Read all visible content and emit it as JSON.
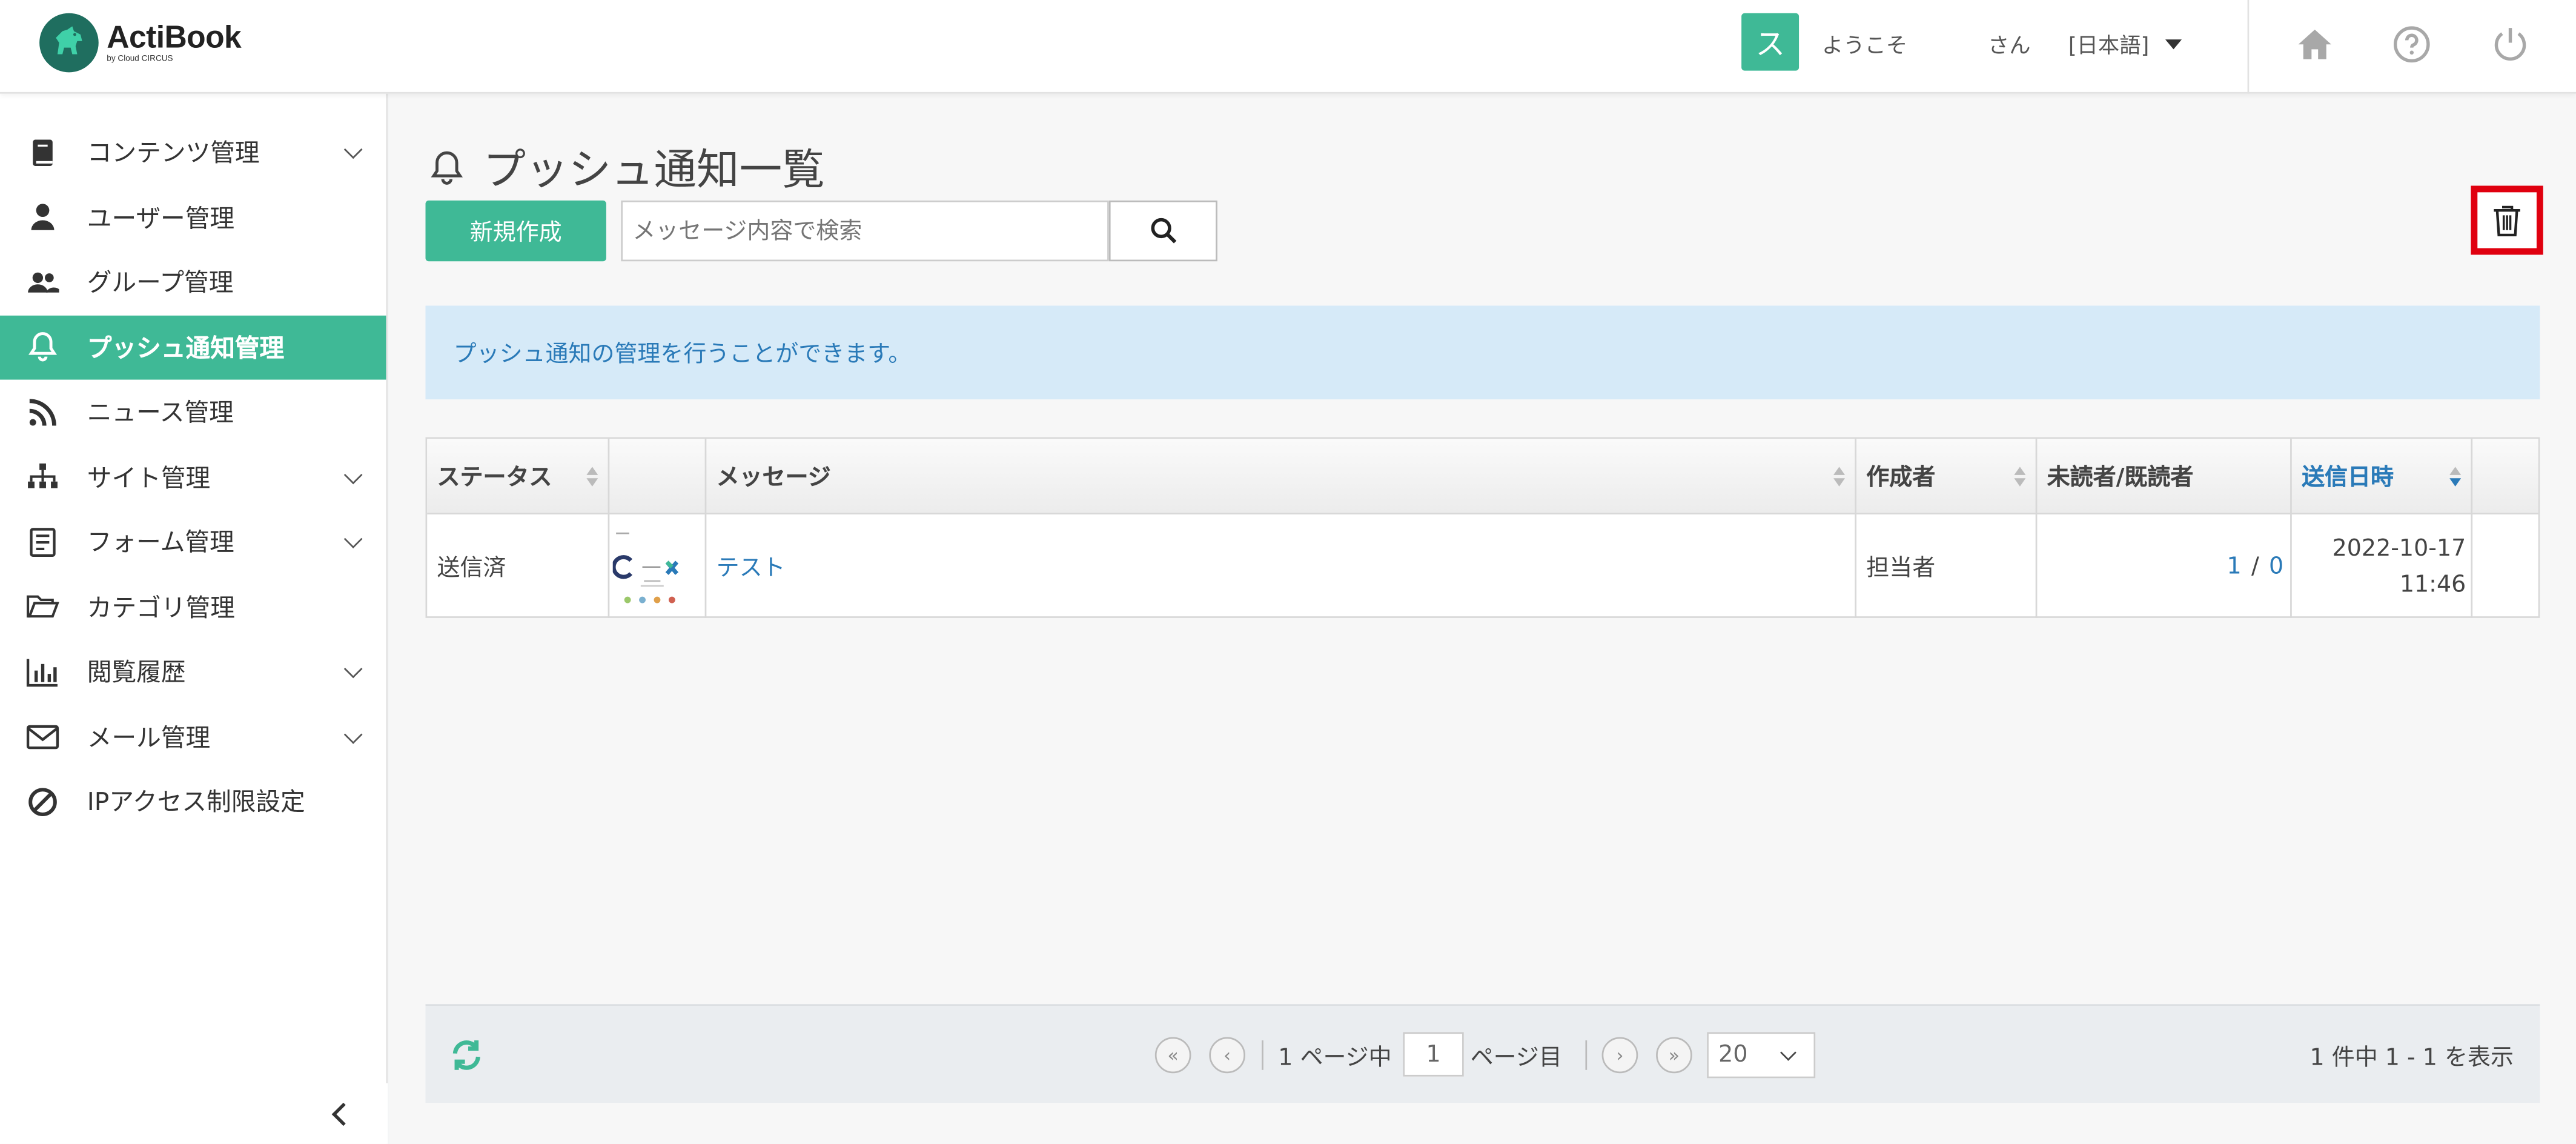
{
  "header": {
    "logo_title": "ActiBook",
    "logo_sub": "by Cloud CIRCUS",
    "user_initial": "ス",
    "welcome": "ようこそ",
    "san": "さん",
    "language": "[日本語]",
    "icons": [
      "home-icon",
      "help-icon",
      "power-icon"
    ]
  },
  "sidebar": {
    "items": [
      {
        "label": "コンテンツ管理",
        "icon": "book-icon",
        "expandable": true
      },
      {
        "label": "ユーザー管理",
        "icon": "user-icon",
        "expandable": false
      },
      {
        "label": "グループ管理",
        "icon": "users-icon",
        "expandable": false
      },
      {
        "label": "プッシュ通知管理",
        "icon": "bell-icon",
        "expandable": false,
        "active": true
      },
      {
        "label": "ニュース管理",
        "icon": "rss-icon",
        "expandable": false
      },
      {
        "label": "サイト管理",
        "icon": "sitemap-icon",
        "expandable": true
      },
      {
        "label": "フォーム管理",
        "icon": "form-icon",
        "expandable": true
      },
      {
        "label": "カテゴリ管理",
        "icon": "folder-icon",
        "expandable": false
      },
      {
        "label": "閲覧履歴",
        "icon": "bar-chart-icon",
        "expandable": true
      },
      {
        "label": "メール管理",
        "icon": "mail-icon",
        "expandable": true
      },
      {
        "label": "IPアクセス制限設定",
        "icon": "ban-icon",
        "expandable": false
      }
    ]
  },
  "main": {
    "title": "プッシュ通知一覧",
    "new_button": "新規作成",
    "search_placeholder": "メッセージ内容で検索",
    "info": "プッシュ通知の管理を行うことができます。",
    "table": {
      "headers": {
        "status": "ステータス",
        "thumb": "",
        "message": "メッセージ",
        "author": "作成者",
        "unread_read": "未読者/既読者",
        "sent_at": "送信日時"
      },
      "rows": [
        {
          "status": "送信済",
          "message": "テスト",
          "author": "担当者",
          "unread": "1",
          "slash": "/",
          "read": "0",
          "sent_date": "2022-10-17",
          "sent_time": "11:46"
        }
      ]
    },
    "pager": {
      "page_of": "1 ページ中",
      "page_value": "1",
      "page_suffix": "ページ目",
      "per_page": "20",
      "count": "1 件中 1 - 1 を表示"
    }
  },
  "colors": {
    "accent": "#3fb996",
    "link": "#2a7ab8",
    "info_bg": "#d6eaf8",
    "highlight": "#e0000f"
  }
}
